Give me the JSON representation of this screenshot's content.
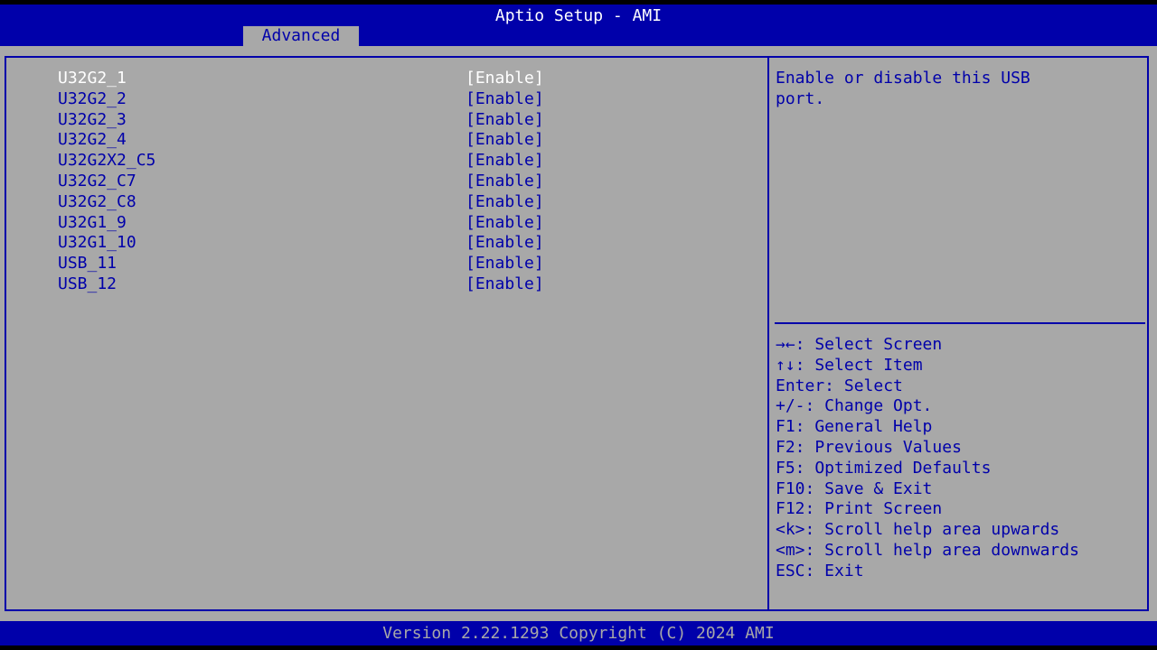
{
  "header": {
    "title": "Aptio Setup - AMI",
    "active_tab": "Advanced"
  },
  "settings": [
    {
      "label": "U32G2_1",
      "value": "[Enable]",
      "selected": true
    },
    {
      "label": "U32G2_2",
      "value": "[Enable]"
    },
    {
      "label": "U32G2_3",
      "value": "[Enable]"
    },
    {
      "label": "U32G2_4",
      "value": "[Enable]"
    },
    {
      "label": "U32G2X2_C5",
      "value": "[Enable]"
    },
    {
      "label": "U32G2_C7",
      "value": "[Enable]"
    },
    {
      "label": "U32G2_C8",
      "value": "[Enable]"
    },
    {
      "label": "U32G1_9",
      "value": "[Enable]"
    },
    {
      "label": "U32G1_10",
      "value": "[Enable]"
    },
    {
      "label": "USB_11",
      "value": "[Enable]"
    },
    {
      "label": "USB_12",
      "value": "[Enable]"
    }
  ],
  "help": {
    "text": "Enable or disable this USB\nport."
  },
  "keys": [
    "→←: Select Screen",
    "↑↓: Select Item",
    "Enter: Select",
    "+/-: Change Opt.",
    "F1: General Help",
    "F2: Previous Values",
    "F5: Optimized Defaults",
    "F10: Save & Exit",
    "F12: Print Screen",
    "<k>: Scroll help area upwards",
    "<m>: Scroll help area downwards",
    "ESC: Exit"
  ],
  "footer": {
    "version": "Version 2.22.1293 Copyright (C) 2024 AMI"
  },
  "colors": {
    "bios_blue": "#0000aa",
    "bios_gray": "#a8a8a8",
    "highlight_white": "#ffffff"
  }
}
